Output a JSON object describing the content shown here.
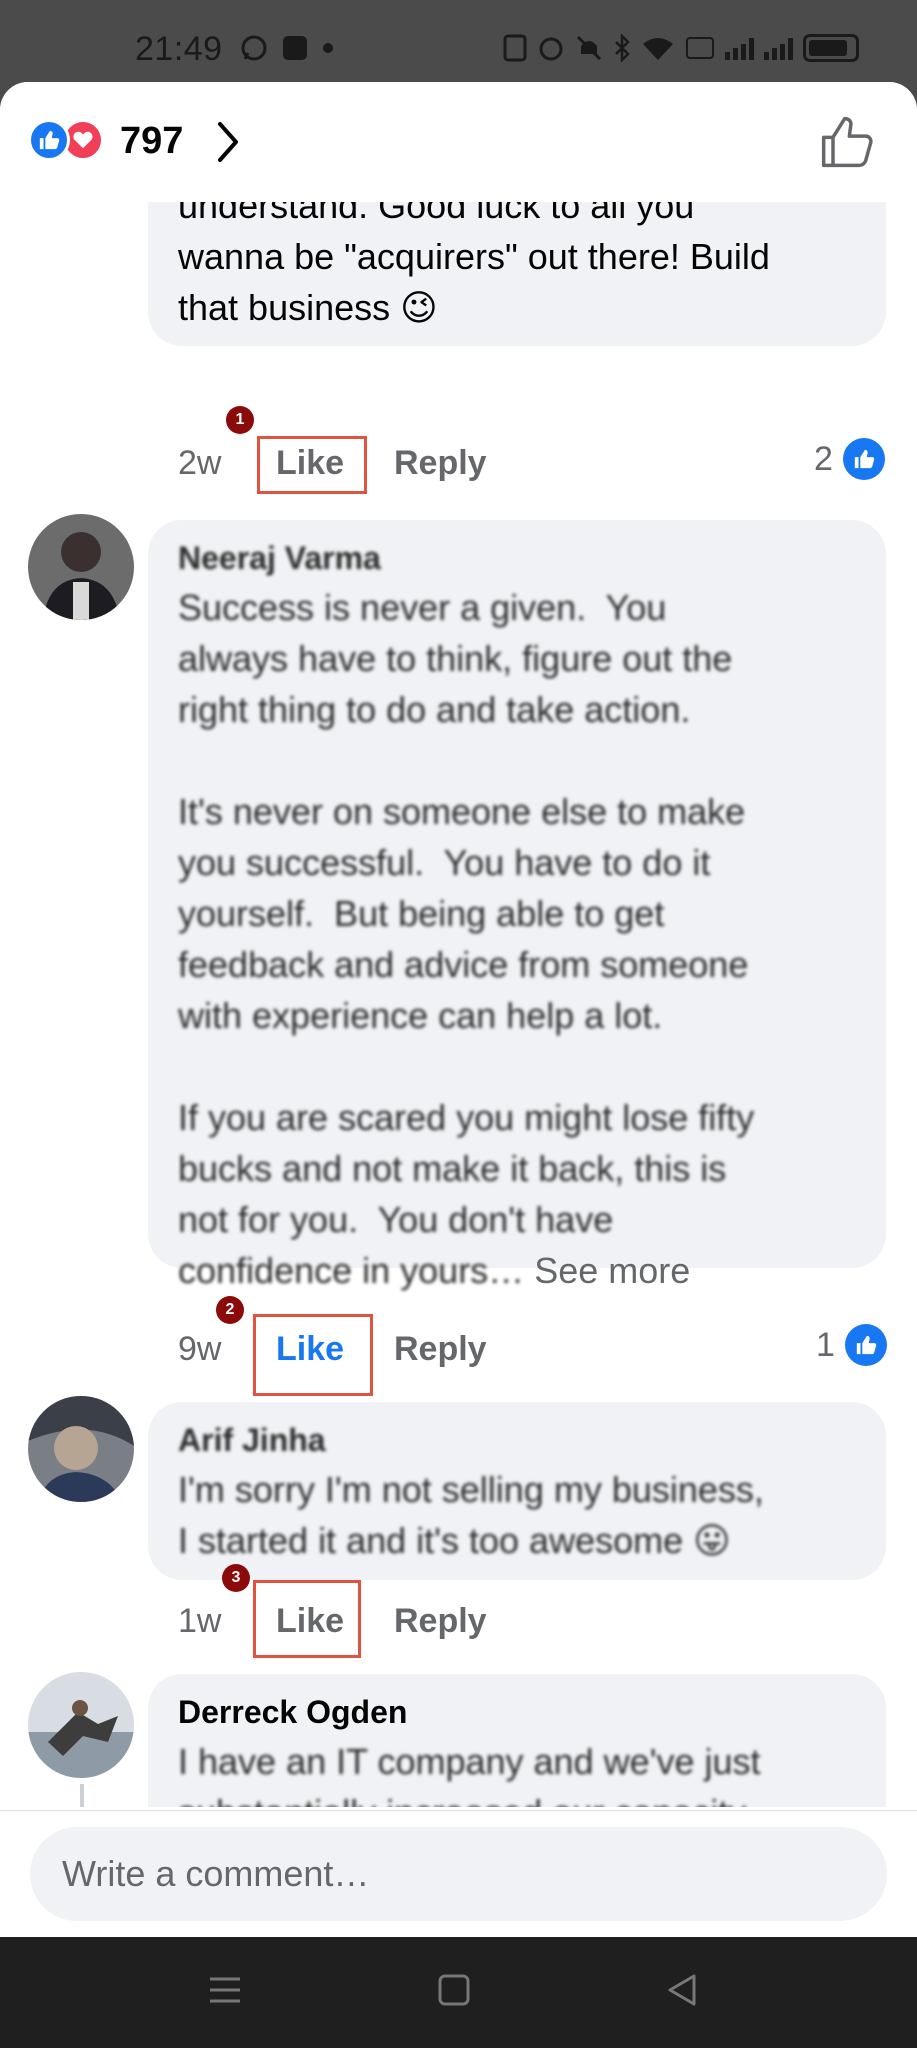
{
  "status_bar": {
    "time": "21:49"
  },
  "header": {
    "reaction_count": "797"
  },
  "comments": [
    {
      "text": "understand. Good luck to all you\nwanna be \"acquirers\" out there! Build\nthat business 😉",
      "time": "2w",
      "like_label": "Like",
      "reply_label": "Reply",
      "like_count": "2",
      "marker": "1"
    },
    {
      "author": "Neeraj Varma",
      "text": "Success is never a given.  You\nalways have to think, figure out the\nright thing to do and take action.\n\nIt's never on someone else to make\nyou successful.  You have to do it\nyourself.  But being able to get\nfeedback and advice from someone\nwith experience can help a lot.\n\nIf you are scared you might lose fifty\nbucks and not make it back, this is\nnot for you.  You don't have\nconfidence in yours…",
      "see_more": "See more",
      "time": "9w",
      "like_label": "Like",
      "reply_label": "Reply",
      "like_count": "1",
      "marker": "2"
    },
    {
      "author": "Arif Jinha",
      "text": "I'm sorry I'm not selling my business,\nI started it and it's too awesome 😛",
      "time": "1w",
      "like_label": "Like",
      "reply_label": "Reply",
      "marker": "3"
    },
    {
      "author": "Derreck Ogden",
      "text": "I have an IT company and we've just\nsubstantially increased our capacity\nin preparation for growth, we're"
    }
  ],
  "composer": {
    "placeholder": "Write a comment…"
  },
  "colors": {
    "accent": "#1877f2",
    "highlight": "#e2533f",
    "marker": "#8b0a0a"
  }
}
